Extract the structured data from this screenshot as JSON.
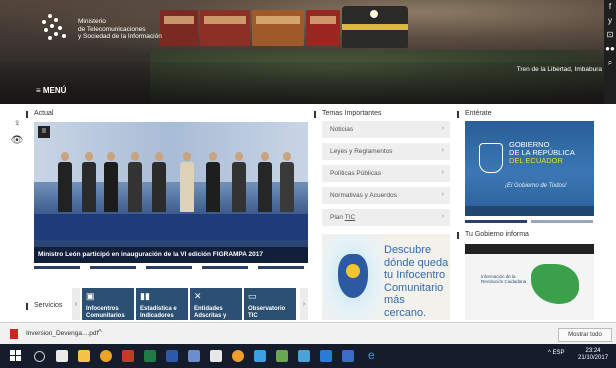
{
  "header": {
    "logo_line1": "Ministerio",
    "logo_line2": "de Telecomunicaciones",
    "logo_line3": "y Sociedad de la Información",
    "menu_label": "≡ MENÚ",
    "caption": "Tren de la Libertad, Imbabura"
  },
  "social": [
    "f",
    "y",
    "⊡",
    "●●",
    "⌕"
  ],
  "accessibility": [
    "♀",
    "👁"
  ],
  "sections": {
    "actual": "Actual",
    "temas": "Temas Importantes",
    "enterate": "Entérate",
    "gobierno": "Tu Gobierno informa",
    "servicios": "Servicios"
  },
  "news": {
    "caption": "Ministro León participó en inauguración de la VI edición FIGRAMPA 2017",
    "pause_label": "II"
  },
  "temas": [
    {
      "label": "Noticias",
      "chevron": "›"
    },
    {
      "label": "Leyes y Reglamentos",
      "chevron": "›"
    },
    {
      "label": "Políticas Públicas",
      "chevron": "›"
    },
    {
      "label": "Normativas y Acuerdos",
      "chevron": "›"
    },
    {
      "label_a": "Plan ",
      "label_b": "TIC",
      "chevron": "›"
    }
  ],
  "banner": {
    "line1": "Descubre",
    "line2": "dónde queda",
    "line3": "tu Infocentro",
    "line4": "Comunitario",
    "line5": "más cercano."
  },
  "enterate": {
    "g1": "GOBIERNO",
    "g2": "DE LA REPÚBLICA",
    "g3": "DEL ECUADOR",
    "tagline": "¡El Gobierno de Todos!"
  },
  "gobierno": {
    "text": "Información de la Revolución Ciudadana"
  },
  "services": [
    {
      "icon": "▣",
      "label": "Infocentros Comunitarios"
    },
    {
      "icon": "▮▮",
      "label": "Estadística e Indicadores"
    },
    {
      "icon": "✕",
      "label": "Entidades Adscritas y"
    },
    {
      "icon": "▭",
      "label": "Observatorio TIC"
    }
  ],
  "services_nav": {
    "prev": "‹",
    "next": "›"
  },
  "download": {
    "filename": "Inversion_Devenga....pdf",
    "chevron": "^",
    "show_all": "Mostrar todo"
  },
  "taskbar": {
    "tray": "^  ESP",
    "time": "23:24",
    "date": "21/10/2017"
  },
  "colors": {
    "accent_blue": "#2c4f74",
    "tema_bg": "#eeeeee",
    "taskbar": "#151d2c"
  }
}
